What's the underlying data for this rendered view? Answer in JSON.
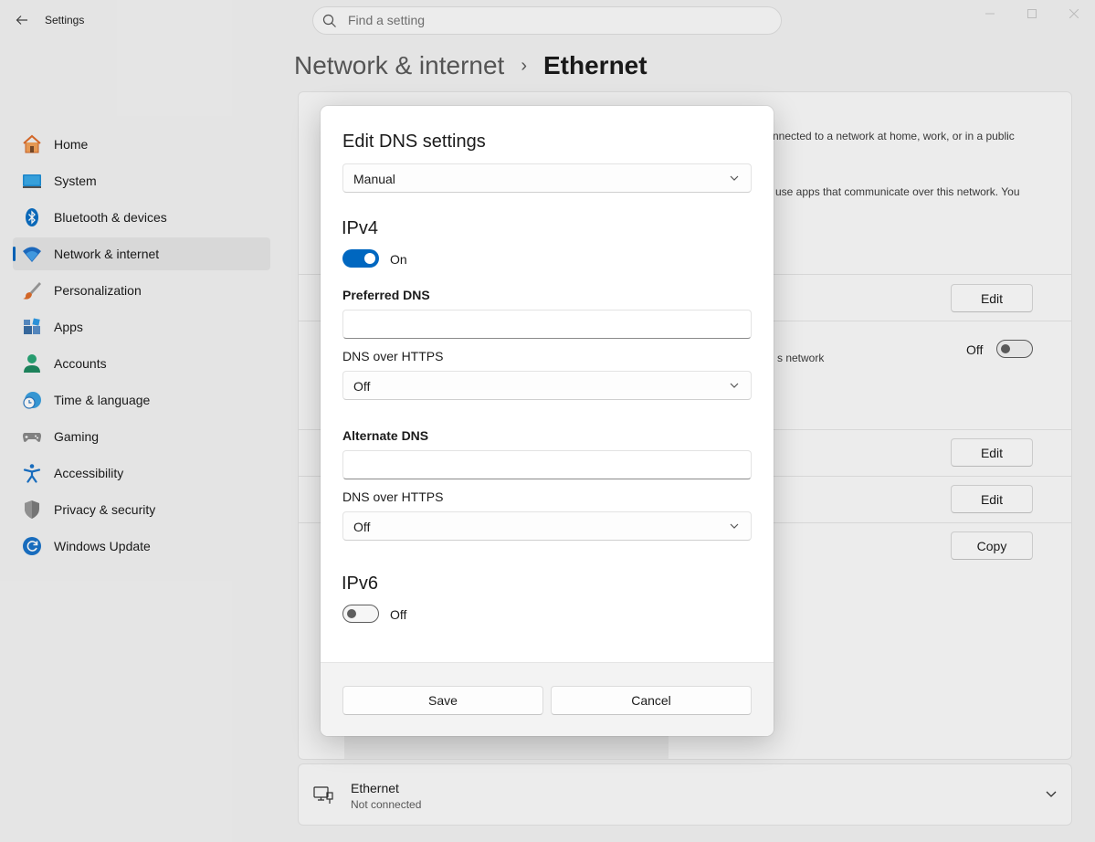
{
  "window": {
    "app_title": "Settings",
    "search_placeholder": "Find a setting"
  },
  "breadcrumb": {
    "parent": "Network & internet",
    "separator": "›",
    "current": "Ethernet"
  },
  "sidebar": {
    "items": [
      {
        "label": "Home",
        "icon": "home-icon",
        "active": false
      },
      {
        "label": "System",
        "icon": "system-icon",
        "active": false
      },
      {
        "label": "Bluetooth & devices",
        "icon": "bluetooth-icon",
        "active": false
      },
      {
        "label": "Network & internet",
        "icon": "wifi-icon",
        "active": true
      },
      {
        "label": "Personalization",
        "icon": "brush-icon",
        "active": false
      },
      {
        "label": "Apps",
        "icon": "apps-icon",
        "active": false
      },
      {
        "label": "Accounts",
        "icon": "account-icon",
        "active": false
      },
      {
        "label": "Time & language",
        "icon": "clock-globe-icon",
        "active": false
      },
      {
        "label": "Gaming",
        "icon": "gamepad-icon",
        "active": false
      },
      {
        "label": "Accessibility",
        "icon": "accessibility-icon",
        "active": false
      },
      {
        "label": "Privacy & security",
        "icon": "shield-icon",
        "active": false
      },
      {
        "label": "Windows Update",
        "icon": "update-icon",
        "active": false
      }
    ]
  },
  "background": {
    "text_1": "nnected to a network at home, work, or in a public",
    "text_2": "use apps that communicate over this network. You",
    "text_3": "s network",
    "edit_label": "Edit",
    "copy_label": "Copy",
    "metered_toggle_state": "Off"
  },
  "ethernet_card": {
    "title": "Ethernet",
    "status": "Not connected"
  },
  "dialog": {
    "title": "Edit DNS settings",
    "mode": "Manual",
    "ipv4": {
      "title": "IPv4",
      "toggle_state": "On",
      "preferred_label": "Preferred DNS",
      "preferred_value": "",
      "preferred_doh_label": "DNS over HTTPS",
      "preferred_doh_value": "Off",
      "alternate_label": "Alternate DNS",
      "alternate_value": "",
      "alternate_doh_label": "DNS over HTTPS",
      "alternate_doh_value": "Off"
    },
    "ipv6": {
      "title": "IPv6",
      "toggle_state": "Off"
    },
    "save_label": "Save",
    "cancel_label": "Cancel"
  },
  "colors": {
    "accent": "#0067c0",
    "background": "#f3f3f3",
    "card": "#fbfbfb"
  }
}
